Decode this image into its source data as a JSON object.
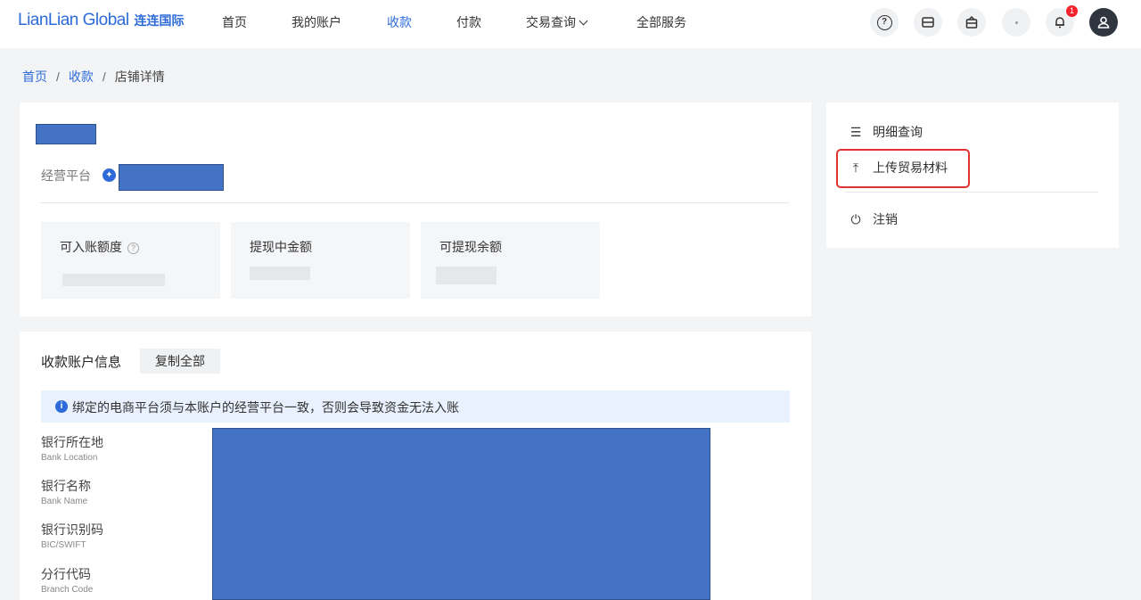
{
  "brand": {
    "logo_en": "LianLian Global",
    "logo_cn": "连连国际",
    "accent": "#2e6bd8"
  },
  "nav": {
    "items": [
      {
        "label": "首页"
      },
      {
        "label": "我的账户"
      },
      {
        "label": "收款",
        "active": true
      },
      {
        "label": "付款"
      },
      {
        "label": "交易查询"
      },
      {
        "label": "全部服务"
      }
    ],
    "tools": {
      "help_icon": "?",
      "notification_count": "1"
    }
  },
  "breadcrumb": {
    "home": "首页",
    "receive": "收款",
    "current": "店铺详情"
  },
  "store": {
    "platform_label": "经营平台",
    "stats": [
      {
        "title": "可入账额度"
      },
      {
        "title": "提现中金额"
      },
      {
        "title": "可提现余额"
      }
    ]
  },
  "account_info": {
    "title": "收款账户信息",
    "copy_all": "复制全部",
    "notice": "绑定的电商平台须与本账户的经营平台一致，否则会导致资金无法入账",
    "fields": [
      {
        "cn": "银行所在地",
        "en": "Bank Location"
      },
      {
        "cn": "银行名称",
        "en": "Bank Name"
      },
      {
        "cn": "银行识别码",
        "en": "BIC/SWIFT"
      },
      {
        "cn": "分行代码",
        "en": "Branch Code"
      }
    ]
  },
  "side_menu": {
    "details": "明细查询",
    "upload": "上传贸易材料",
    "cancel": "注销"
  },
  "colors": {
    "redaction": "#4472c4",
    "highlight": "#e0322f",
    "notice_bg": "#e8f1fd"
  }
}
